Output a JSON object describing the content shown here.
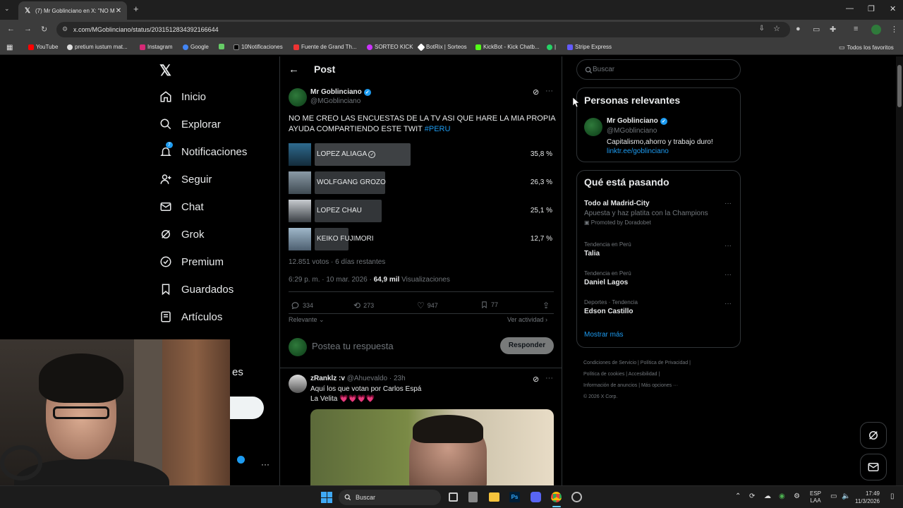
{
  "browser": {
    "tab_title": "(7) Mr Goblinciano en X: \"NO M",
    "url": "x.com/MGoblinciano/status/2031512834392166644",
    "bookmarks": [
      "YouTube",
      "pretium iustum mat...",
      "Instagram",
      "Google",
      "10Notificaciones",
      "Fuente de Grand Th...",
      "SORTEO KICK",
      "BotRix | Sorteos",
      "KickBot - Kick Chatb...",
      "|",
      "Stripe Express"
    ],
    "all_bookmarks": "Todos los favoritos"
  },
  "nav": {
    "items": [
      {
        "label": "Inicio",
        "icon": "home-icon"
      },
      {
        "label": "Explorar",
        "icon": "search-icon"
      },
      {
        "label": "Notificaciones",
        "icon": "bell-icon"
      },
      {
        "label": "Seguir",
        "icon": "follow-icon"
      },
      {
        "label": "Chat",
        "icon": "mail-icon"
      },
      {
        "label": "Grok",
        "icon": "grok-icon"
      },
      {
        "label": "Premium",
        "icon": "premium-icon"
      },
      {
        "label": "Guardados",
        "icon": "bookmark-icon"
      },
      {
        "label": "Artículos",
        "icon": "articles-icon"
      }
    ],
    "notif_badge": "7",
    "partial_text": "es"
  },
  "post": {
    "header": "Post",
    "author_name": "Mr Goblinciano",
    "author_handle": "@MGoblinciano",
    "text": "NO ME CREO LAS ENCUESTAS DE LA TV ASI QUE HARE LA MIA PROPIA AYUDA COMPARTIENDO ESTE TWIT",
    "hashtag": "#PERU",
    "poll": [
      {
        "label": "LOPEZ ALIAGA",
        "percent": "35,8 %",
        "value": 35.8,
        "winner": true
      },
      {
        "label": "WOLFGANG GROZO",
        "percent": "26,3 %",
        "value": 26.3,
        "winner": false
      },
      {
        "label": "LOPEZ CHAU",
        "percent": "25,1 %",
        "value": 25.1,
        "winner": false
      },
      {
        "label": "KEIKO FUJIMORI",
        "percent": "12,7 %",
        "value": 12.7,
        "winner": false
      }
    ],
    "poll_meta": "12.851 votos · 6 días restantes",
    "time": "6:29 p. m. · 10 mar. 2026 · ",
    "views_count": "64,9 mil",
    "views_label": " Visualizaciones",
    "replies": "334",
    "reposts": "273",
    "likes": "947",
    "bookmarks": "77",
    "relevant": "Relevante",
    "activity": "Ver actividad",
    "reply_placeholder": "Postea tu respuesta",
    "reply_button": "Responder"
  },
  "reply": {
    "name": "zRanklz :v",
    "handle": "@Ahuevaldo · 23h",
    "line1": "Aquí los que votan por Carlos Espá",
    "line2": "La Velita 💗💗💗💗"
  },
  "sidebar": {
    "search_placeholder": "Buscar",
    "relevant_title": "Personas relevantes",
    "person_name": "Mr Goblinciano",
    "person_handle": "@MGoblinciano",
    "person_bio": "Capitalismo,ahorro y trabajo duro!",
    "person_link": "linktr.ee/goblinciano",
    "trending_title": "Qué está pasando",
    "trends": [
      {
        "meta": "",
        "title": "Todo al Madrid-City",
        "sub": "Apuesta y haz platita con la Champions",
        "promo": "Promoted by Doradobet"
      },
      {
        "meta": "Tendencia en Perú",
        "title": "Talia"
      },
      {
        "meta": "Tendencia en Perú",
        "title": "Daniel Lagos"
      },
      {
        "meta": "Deportes · Tendencia",
        "title": "Edson Castillo"
      }
    ],
    "show_more": "Mostrar más",
    "footer1": "Condiciones de Servicio  |   Política de Privacidad  |",
    "footer2": "Política de cookies  |   Accesibilidad  |",
    "footer3": "Información de anuncios  |   Más opciones ···",
    "footer4": "© 2026 X Corp."
  },
  "taskbar": {
    "search": "Buscar",
    "lang1": "ESP",
    "lang2": "LAA",
    "time": "17:49",
    "date": "11/3/2026"
  },
  "colors": {
    "accent": "#1d9bf0",
    "bg": "#000000",
    "border": "#2f3336",
    "muted": "#71767b"
  }
}
